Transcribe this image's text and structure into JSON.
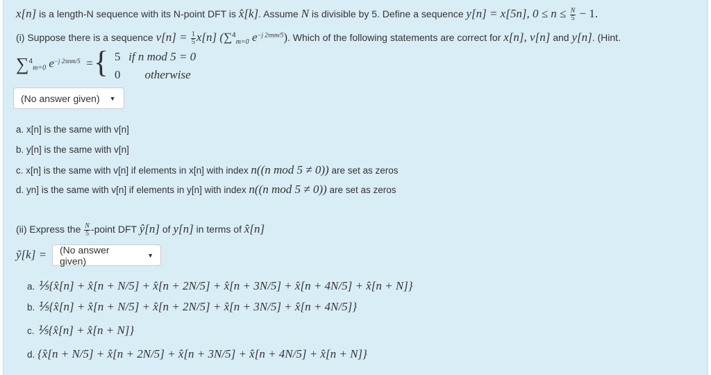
{
  "intro": {
    "text1": " is a length-N sequence with its N-point DFT is ",
    "text2": ". Assume ",
    "text3": " is divisible by 5. Define a sequence ",
    "math_x": "x[n]",
    "math_xhat": "x̂[k]",
    "math_N": "N",
    "math_y_def": "y[n] = x[5n], 0 ≤ n ≤ ",
    "math_y_tail": " − 1."
  },
  "part1": {
    "prefix": "(i) Suppose there is a sequence ",
    "v_def": "v[n] = ",
    "v_expr": "x[n] (∑",
    "sum_sup": "4",
    "sum_sub": "m=0",
    "exp": " e",
    "exp_power": "−j 2πnm/5",
    "close": ")",
    "question": ". Which of the following statements are correct for ",
    "vars": "x[n], v[n]",
    "and": " and ",
    "yvar": "y[n]",
    "hint": ". (Hint.",
    "hint_case1_val": "5",
    "hint_case1_cond": "if n  mod 5 = 0",
    "hint_case2_val": "0",
    "hint_case2_cond": "otherwise",
    "select_value": "(No answer given)",
    "options": [
      {
        "letter": "a.",
        "text": "x[n] is the same with v[n]"
      },
      {
        "letter": "b.",
        "text": "y[n] is the same with v[n]"
      },
      {
        "letter": "c.",
        "text": "x[n] is the same with v[n] if elements in x[n] with index ",
        "math": "n((n  mod 5 ≠ 0))",
        "tail": " are set as zeros"
      },
      {
        "letter": "d.",
        "text": "yn] is the same with v[n] if elements in y[n] with index ",
        "math": "n((n  mod 5 ≠ 0))",
        "tail": " are set as zeros"
      }
    ]
  },
  "part2": {
    "prefix": "(ii) Express the ",
    "frac_num": "N",
    "frac_den": "5",
    "mid": "-point DFT ",
    "yhat": "ŷ[n]",
    "of": " of ",
    "yn": "y[n]",
    "terms": " in terms of ",
    "xhat": "x̂[n]",
    "lhs": "ỹ[k] =",
    "select_value": "(No answer given)",
    "options": [
      {
        "letter": "a.",
        "expr": "⅕{x̂[n] + x̂[n + N/5] + x̂[n + 2N/5] + x̂[n + 3N/5] + x̂[n + 4N/5] + x̂[n + N]}"
      },
      {
        "letter": "b.",
        "expr": "⅕{x̂[n] + x̂[n + N/5] + x̂[n + 2N/5] + x̂[n + 3N/5] + x̂[n + 4N/5]}"
      },
      {
        "letter": "c.",
        "expr": "⅕{x̂[n] + x̂[n + N]}"
      },
      {
        "letter": "d.",
        "expr": "{x̂[n + N/5] + x̂[n + 2N/5] + x̂[n + 3N/5] + x̂[n + 4N/5] + x̂[n + N]}"
      }
    ]
  }
}
